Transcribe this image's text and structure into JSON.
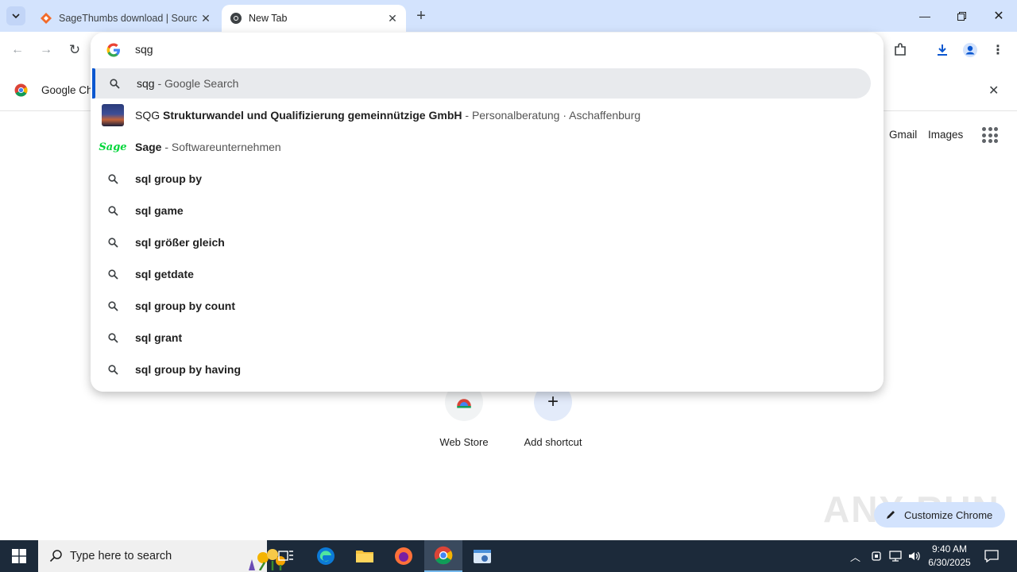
{
  "tabs": [
    {
      "title": "SageThumbs download | Sourc",
      "active": false
    },
    {
      "title": "New Tab",
      "active": true
    }
  ],
  "omnibox": {
    "input_value": "sqg",
    "suggestions": [
      {
        "type": "search",
        "bold": "",
        "text": "sqg",
        "desc": "Google Search",
        "selected": true
      },
      {
        "type": "entity",
        "prefix": "SQG ",
        "bold": "Strukturwandel und Qualifizierung gemeinnützige GmbH",
        "desc": "Personalberatung · Aschaffenburg"
      },
      {
        "type": "entity",
        "prefix": "",
        "bold": "Sage",
        "desc": "Softwareunternehmen",
        "logo_text": "Sage"
      },
      {
        "type": "search",
        "text": "sql group by"
      },
      {
        "type": "search",
        "text": "sql game"
      },
      {
        "type": "search",
        "text": "sql größer gleich"
      },
      {
        "type": "search",
        "text": "sql getdate"
      },
      {
        "type": "search",
        "text": "sql group by count"
      },
      {
        "type": "search",
        "text": "sql grant"
      },
      {
        "type": "search",
        "text": "sql group by having"
      }
    ]
  },
  "infobar": {
    "text": "Google Ch"
  },
  "ntp": {
    "links": [
      "Gmail",
      "Images"
    ],
    "shortcuts": [
      {
        "label": "Web Store"
      },
      {
        "label": "Add shortcut"
      }
    ],
    "customize_label": "Customize Chrome",
    "watermark": "ANY RUN"
  },
  "taskbar": {
    "search_placeholder": "Type here to search",
    "time": "9:40 AM",
    "date": "6/30/2025"
  },
  "colors": {
    "accent": "#0b57d0",
    "tabstrip": "#d3e3fd",
    "taskbar": "#1c2a3a"
  }
}
